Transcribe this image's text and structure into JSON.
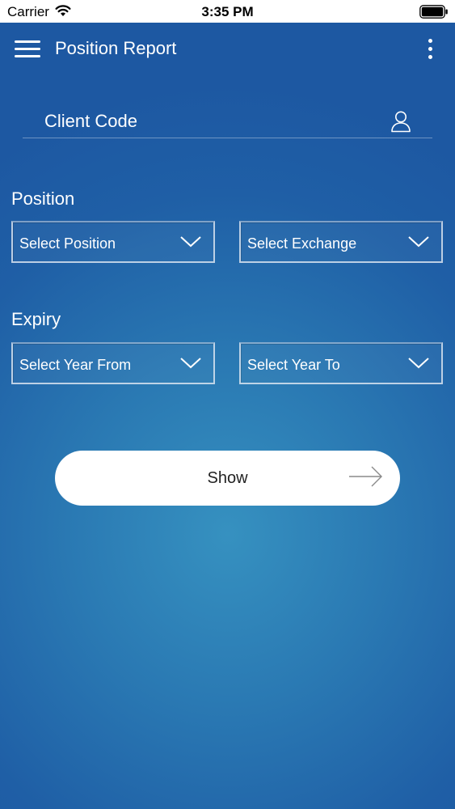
{
  "status_bar": {
    "carrier": "Carrier",
    "time": "3:35 PM"
  },
  "header": {
    "title": "Position Report"
  },
  "client_code": {
    "placeholder": "Client Code"
  },
  "position": {
    "label": "Position",
    "position_select": "Select Position",
    "exchange_select": "Select Exchange"
  },
  "expiry": {
    "label": "Expiry",
    "year_from_select": "Select Year From",
    "year_to_select": "Select Year To"
  },
  "show_button": {
    "label": "Show"
  },
  "colors": {
    "background": "#2a79b3",
    "button": "#ffffff",
    "text": "#ffffff"
  },
  "icons": [
    "wifi-icon",
    "battery-icon",
    "menu-icon",
    "more-vertical-icon",
    "user-icon",
    "chevron-down-icon",
    "arrow-right-icon"
  ]
}
